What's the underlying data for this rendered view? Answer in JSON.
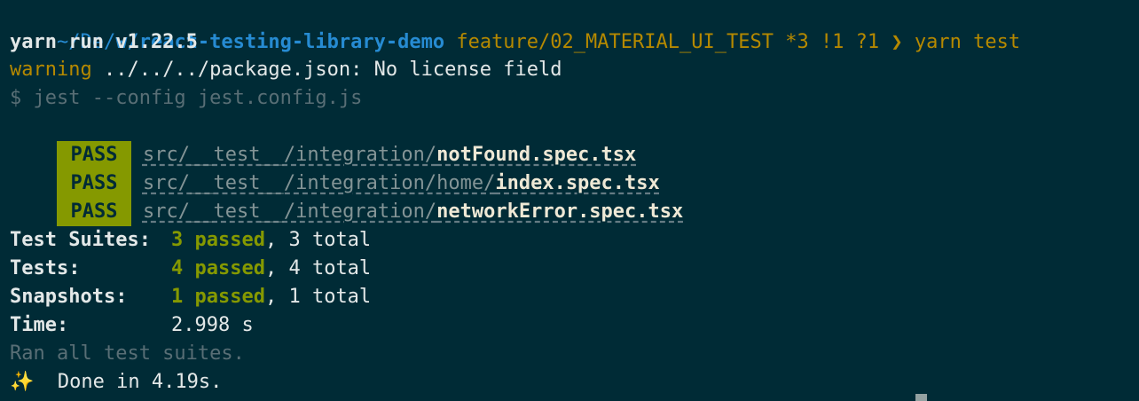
{
  "prompt": {
    "dir_prefix": "~/De/w/",
    "dir_name": "react-testing-library-demo",
    "branch": "feature/02_MATERIAL_UI_TEST",
    "git_status": "*3 !1 ?1",
    "arrow": "❯",
    "command": "yarn test"
  },
  "output": {
    "yarn_version": "yarn run v1.22.5",
    "warning_label": "warning",
    "warning_text": " ../../../package.json: No license field",
    "jest_command": "$ jest --config jest.config.js"
  },
  "tests": [
    {
      "status": "PASS",
      "dir": "src/__test__/integration/",
      "file": "notFound.spec.tsx"
    },
    {
      "status": "PASS",
      "dir": "src/__test__/integration/home/",
      "file": "index.spec.tsx"
    },
    {
      "status": "PASS",
      "dir": "src/__test__/integration/",
      "file": "networkError.spec.tsx"
    }
  ],
  "summary": {
    "suites": {
      "label": "Test Suites:",
      "passed": "3 passed",
      "total": ", 3 total"
    },
    "tests": {
      "label": "Tests:",
      "passed": "4 passed",
      "total": ", 4 total"
    },
    "snapshots": {
      "label": "Snapshots:",
      "passed": "1 passed",
      "total": ", 1 total"
    },
    "time": {
      "label": "Time:",
      "value": "2.998 s"
    },
    "ran_all": "Ran all test suites.",
    "done_icon": "✨",
    "done_text": "  Done in 4.19s."
  },
  "colors": {
    "background": "#002b36",
    "pass_badge": "#859900",
    "directory": "#268bd2",
    "branch": "#b58900"
  }
}
